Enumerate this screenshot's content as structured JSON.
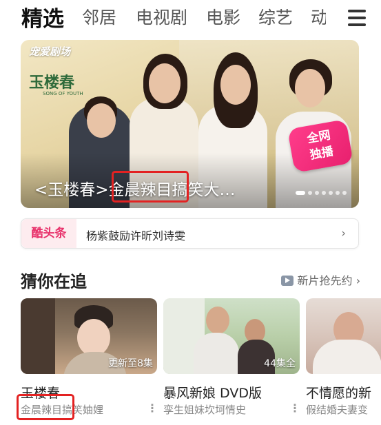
{
  "nav": {
    "tabs": [
      {
        "label": "精选",
        "active": true
      },
      {
        "label": "邻居",
        "active": false
      },
      {
        "label": "电视剧",
        "active": false
      },
      {
        "label": "电影",
        "active": false
      },
      {
        "label": "综艺",
        "active": false
      },
      {
        "label": "动",
        "active": false
      }
    ],
    "menu_icon": "hamburger-menu-icon"
  },
  "banner": {
    "brand": "宠爱剧场",
    "logo_title": "玉楼春",
    "logo_subtitle": "SONG OF YOUTH",
    "badge_line1": "全网",
    "badge_line2": "独播",
    "caption": "<玉楼春>金晨辣目搞笑大…",
    "pager": {
      "count": 7,
      "active": 0
    }
  },
  "headline": {
    "logo": "酷头条",
    "text": "杨紫鼓励许昕刘诗雯",
    "arrow": "›"
  },
  "section": {
    "title": "猜你在追",
    "link_label": "新片抢先约",
    "link_arrow": "›"
  },
  "cards": [
    {
      "title": "玉楼春",
      "subtitle": "金晨辣目搞笑妯娌",
      "episode_badge": "更新至8集",
      "more": "⋮"
    },
    {
      "title": "暴风新娘 DVD版",
      "subtitle": "孪生姐妹坎坷情史",
      "episode_badge": "44集全",
      "more": "⋮"
    },
    {
      "title": "不情愿的新",
      "subtitle": "假结婚夫妻变",
      "episode_badge": "",
      "more": ""
    }
  ],
  "colors": {
    "highlight": "#e32222",
    "accent_pink": "#e8306a"
  }
}
